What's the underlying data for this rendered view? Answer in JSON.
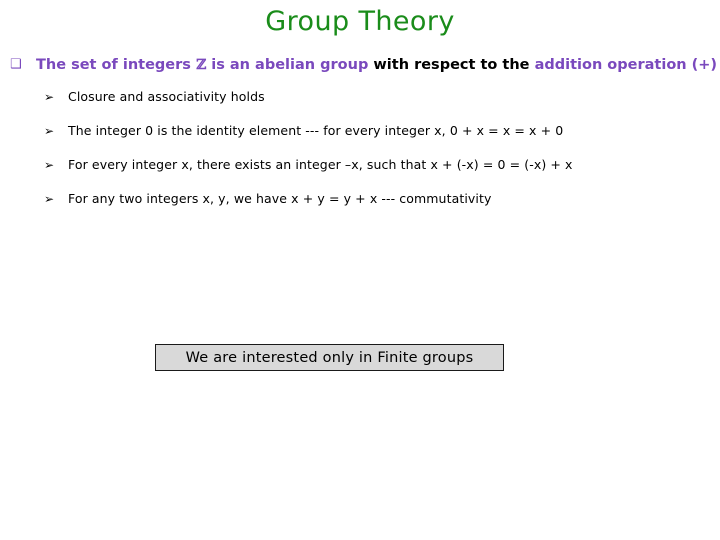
{
  "slide": {
    "title": "Group Theory",
    "title_color": "#1a8c1a",
    "background_color": "#ffffff",
    "level1": {
      "bullet_icon": "hollow-square-bullet",
      "bullet_glyph": "❑",
      "bullet_color": "#7a49bd",
      "segments": {
        "part1": "The set of integers ",
        "zsymbol": "ℤ",
        "part2": " is an abelian group ",
        "part3": "with respect to the ",
        "part4": "addition operation (+)"
      },
      "full_text": "The set of integers ℤ is an abelian group with respect to the addition operation (+)"
    },
    "sub_bullets": [
      {
        "bullet_glyph": "➢",
        "text": "Closure and associativity holds"
      },
      {
        "bullet_glyph": "➢",
        "text": "The  integer 0 is the identity element --- for every integer x, 0 + x = x = x + 0"
      },
      {
        "bullet_glyph": "➢",
        "text": "For every integer x, there exists an integer –x, such that x + (-x) = 0 = (-x) + x"
      },
      {
        "bullet_glyph": "➢",
        "text": "For any two integers x, y, we have x + y = y + x --- commutativity"
      }
    ],
    "highlight": {
      "text": "We are interested only in Finite groups",
      "fill_color": "#d9d9d9",
      "border_color": "#1a1a1a"
    }
  }
}
